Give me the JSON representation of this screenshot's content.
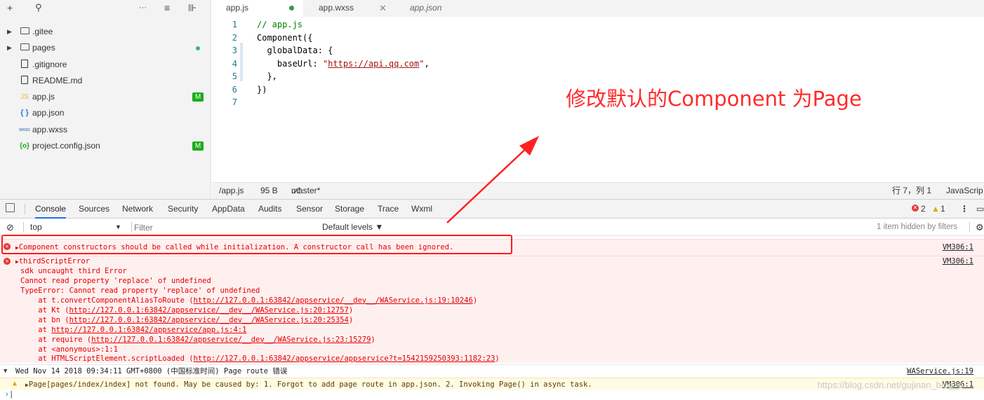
{
  "explorer": {
    "toolbar": {
      "add": "+",
      "search": "⚲",
      "more": "···",
      "collapse": "≡",
      "split": "⊪"
    },
    "items": [
      {
        "name": ".gitee",
        "type": "folder",
        "status": ""
      },
      {
        "name": "pages",
        "type": "folder",
        "status": "dot"
      },
      {
        "name": ".gitignore",
        "type": "file",
        "status": ""
      },
      {
        "name": "README.md",
        "type": "file",
        "status": ""
      },
      {
        "name": "app.js",
        "type": "js",
        "icon": "JS",
        "status": "M"
      },
      {
        "name": "app.json",
        "type": "json",
        "icon": "{ }",
        "status": ""
      },
      {
        "name": "app.wxss",
        "type": "wxss",
        "icon": "wxss",
        "status": ""
      },
      {
        "name": "project.config.json",
        "type": "config",
        "icon": "{o}",
        "status": "M"
      }
    ]
  },
  "editor": {
    "tabs": [
      {
        "label": "app.js",
        "active": true
      },
      {
        "label": "app.wxss",
        "active": false
      },
      {
        "label": "app.json",
        "active": false
      }
    ],
    "line_numbers": [
      "1",
      "2",
      "3",
      "4",
      "5",
      "6",
      "7"
    ],
    "code": {
      "l1": "// app.js",
      "l2": "Component({",
      "l3": "  globalData: {",
      "l4_key": "    baseUrl: ",
      "l4_q1": "\"",
      "l4_url": "https://api.qq.com",
      "l4_q2": "\"",
      "l4_end": ",",
      "l5": "  },",
      "l6": "})",
      "l7": ""
    },
    "annotation": "修改默认的Component 为Page"
  },
  "statusbar": {
    "path": "/app.js",
    "size": "95 B",
    "branch": "master*",
    "position": "行 7，列 1",
    "language": "JavaScrip"
  },
  "devtools": {
    "tabs": [
      "Console",
      "Sources",
      "Network",
      "Security",
      "AppData",
      "Audits",
      "Sensor",
      "Storage",
      "Trace",
      "Wxml"
    ],
    "error_count": "2",
    "warning_count": "1",
    "context": "top",
    "filter_placeholder": "Filter",
    "levels": "Default levels ▼",
    "hidden": "1 item hidden by filters"
  },
  "console": {
    "err1": {
      "text": "Component constructors should be called while initialization. A constructor call has been ignored.",
      "src": "VM306:1"
    },
    "err2": {
      "head": "thirdScriptError",
      "src": "VM306:1",
      "l1": "sdk uncaught third Error",
      "l2": "Cannot read property 'replace' of undefined",
      "l3": "TypeError: Cannot read property 'replace' of undefined",
      "s1_pre": "    at t.convertComponentAliasToRoute (",
      "s1_link": "http://127.0.0.1:63842/appservice/__dev__/WAService.js:19:10246",
      "s1_post": ")",
      "s2_pre": "    at Kt (",
      "s2_link": "http://127.0.0.1:63842/appservice/__dev__/WAService.js:20:12757",
      "s2_post": ")",
      "s3_pre": "    at bn (",
      "s3_link": "http://127.0.0.1:63842/appservice/__dev__/WAService.js:20:25354",
      "s3_post": ")",
      "s4_pre": "    at ",
      "s4_link": "http://127.0.0.1:63842/appservice/app.js:4:1",
      "s5_pre": "    at require (",
      "s5_link": "http://127.0.0.1:63842/appservice/__dev__/WAService.js:23:15279",
      "s5_post": ")",
      "s6": "    at <anonymous>:1:1",
      "s7_pre": "    at HTMLScriptElement.scriptLoaded (",
      "s7_link": "http://127.0.0.1:63842/appservice/appservice?t=1542159250393:1182:23",
      "s7_post": ")"
    },
    "info": {
      "text": "Wed Nov 14 2018 09:34:11 GMT+0800 (中国标准时间) Page route 错误",
      "src": "WAService.js:19"
    },
    "warn": {
      "text": "Page[pages/index/index] not found. May be caused by: 1. Forgot to add page route in app.json. 2. Invoking Page() in async task.",
      "src": "VM306:1"
    },
    "watermark": "https://blog.csdn.net/gujinan_blog_s"
  },
  "colors": {
    "annotation": "#ff2a2a",
    "error_bg": "#fff0f0",
    "warn_bg": "#fffbe5",
    "badge_green": "#1aad19"
  }
}
